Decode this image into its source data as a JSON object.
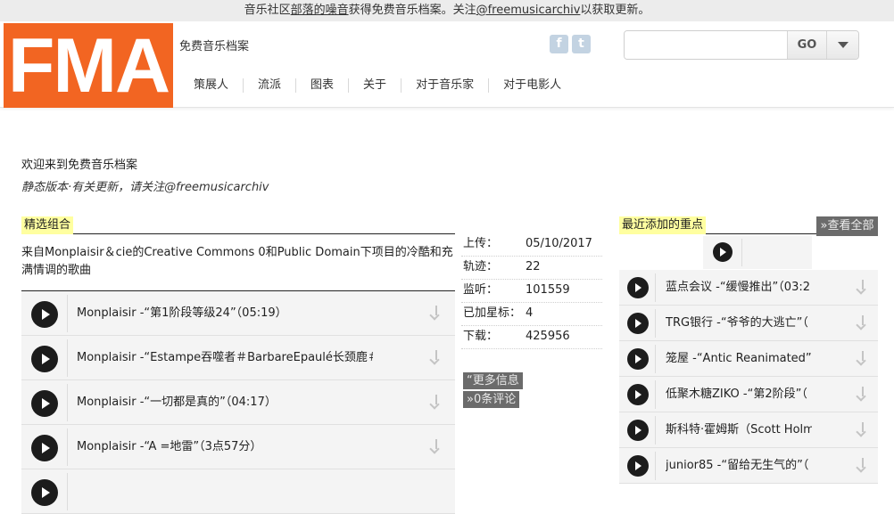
{
  "topbar": {
    "prefix": "音乐社区",
    "link1": "部落的噪音",
    "middle": "获得免费音乐档案。关注",
    "link2": "@freemusicarchiv",
    "suffix": "以获取更新。"
  },
  "header": {
    "logo_text": "FMA",
    "tagline": "免费音乐档案",
    "social": [
      {
        "icon": "facebook-icon",
        "glyph": "f"
      },
      {
        "icon": "twitter-icon",
        "glyph": "t"
      }
    ],
    "search": {
      "value": "",
      "placeholder": "",
      "go_label": "GO"
    },
    "nav": [
      "策展人",
      "流派",
      "图表",
      "关于",
      "对于音乐家",
      "对于电影人"
    ]
  },
  "intro": {
    "welcome": "欢迎来到免费音乐档案",
    "static_note": "静态版本·有关更新，请关注@freemusicarchiv"
  },
  "featured_mix": {
    "title": "精选组合",
    "description": "来自Monplaisir＆cie的Creative Commons 0和Public Domain下项目的冷酷和充满情调的歌曲",
    "tracks": [
      "Monplaisir -“第1阶段等级24”（05:19）",
      "Monplaisir -“Estampe吞噬者＃BarbareEpaulé长颈鹿＃佬瘟",
      "Monplaisir -“一切都是真的”（04:17）",
      "Monplaisir -“A =地雷”（3点57分）"
    ]
  },
  "stats": [
    {
      "label": "上传：",
      "value": "05/10/2017"
    },
    {
      "label": "轨迹：",
      "value": "22"
    },
    {
      "label": "监听：",
      "value": "101559"
    },
    {
      "label": "已加星标：",
      "value": "4"
    },
    {
      "label": "下载：",
      "value": "425956"
    }
  ],
  "actions": {
    "more_info": "“更多信息",
    "comments": "»0条评论"
  },
  "recent": {
    "title": "最近添加的重点",
    "view_all": "»查看全部",
    "tracks": [
      "蓝点会议 -“缓慢推出”（03:2",
      "TRG银行 -“爷爷的大逃亡”（",
      "笼屋 -“Antic Reanimated”（",
      "低聚木糖ZIKO -“第2阶段”（",
      "斯科特·霍姆斯（Scott Holm",
      "junior85 -“留给无生气的”（"
    ]
  },
  "colors": {
    "brand": "#f26522",
    "highlight": "#ffffa0",
    "dark_button": "#6b6b6b"
  }
}
